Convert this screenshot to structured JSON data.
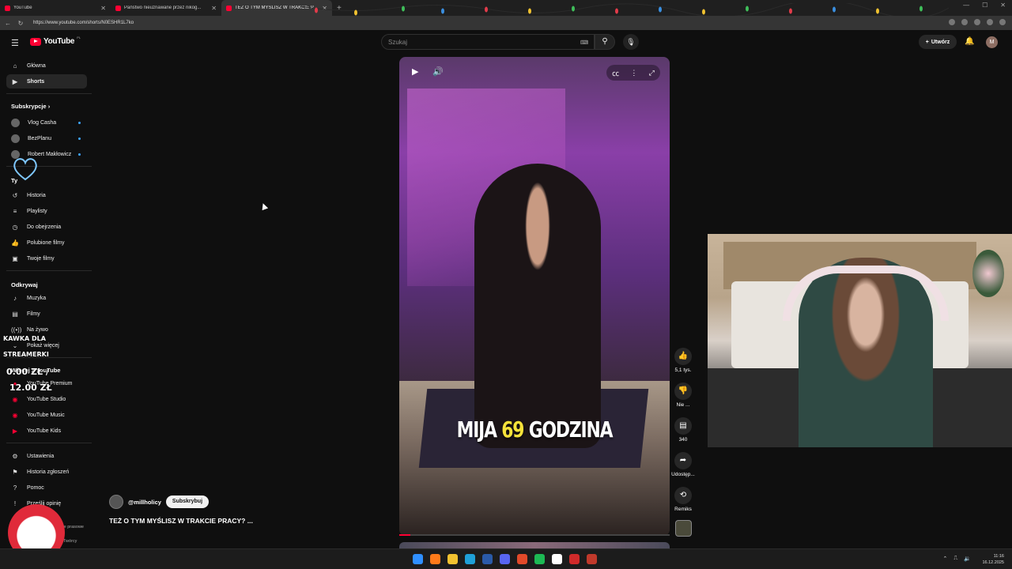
{
  "browser": {
    "tabs": [
      {
        "title": "YouTube"
      },
      {
        "title": "Państwo nieuznawane przez nikog..."
      },
      {
        "title": "TEŻ O TYM MYŚLISZ W TRAKCIE P..."
      }
    ],
    "url": "https://www.youtube.com/shorts/N0ESHR1L7ko"
  },
  "topbar": {
    "logo_text": "YouTube",
    "logo_country": "PL",
    "search_placeholder": "Szukaj",
    "create_label": "Utwórz",
    "avatar_letter": "M"
  },
  "sidebar": {
    "main": [
      {
        "label": "Główna",
        "icon": "home-icon"
      },
      {
        "label": "Shorts",
        "icon": "shorts-icon"
      }
    ],
    "subs_heading": "Subskrypcje",
    "subscriptions": [
      {
        "label": "Vlog Casha"
      },
      {
        "label": "BezPlanu"
      },
      {
        "label": "Robert Makłowicz"
      }
    ],
    "you_heading": "Ty",
    "you": [
      {
        "label": "Historia",
        "icon": "history-icon"
      },
      {
        "label": "Playlisty",
        "icon": "playlist-icon"
      },
      {
        "label": "Do obejrzenia",
        "icon": "watch-later-icon"
      },
      {
        "label": "Polubione filmy",
        "icon": "like-icon"
      },
      {
        "label": "Twoje filmy",
        "icon": "video-icon"
      }
    ],
    "explore_heading": "Odkrywaj",
    "explore": [
      {
        "label": "Muzyka",
        "icon": "music-icon"
      },
      {
        "label": "Filmy",
        "icon": "film-icon"
      },
      {
        "label": "Na żywo",
        "icon": "live-icon"
      },
      {
        "label": "Pokaż więcej",
        "icon": "chevron-down-icon"
      }
    ],
    "more_heading": "Więcej z YouTube",
    "more": [
      {
        "label": "YouTube Premium"
      },
      {
        "label": "YouTube Studio"
      },
      {
        "label": "YouTube Music"
      },
      {
        "label": "YouTube Kids"
      }
    ],
    "settings": [
      {
        "label": "Ustawienia",
        "icon": "gear-icon"
      },
      {
        "label": "Historia zgłoszeń",
        "icon": "flag-icon"
      },
      {
        "label": "Pomoc",
        "icon": "help-icon"
      },
      {
        "label": "Prześlij opinię",
        "icon": "feedback-icon"
      }
    ],
    "footer_partial": [
      "Informacje prasowe",
      "Twórcy"
    ]
  },
  "short": {
    "caption_pre": "MIJA",
    "caption_num": "69",
    "caption_post": "GODZINA",
    "channel": "@millholicy",
    "subscribe_label": "Subskrybuj",
    "title": "TEŻ O TYM MYŚLISZ W TRAKCIE PRACY? ...",
    "progress": 0.04,
    "actions": {
      "likes": "5,1 tys.",
      "dislike": "Nie ...",
      "comments": "340",
      "share": "Udostęp...",
      "remix": "Remiks"
    }
  },
  "overlay": {
    "donation_line1": "KAWKA DLA",
    "donation_line2": "STREAMERKI",
    "amount1": "0.00 ZŁ /",
    "amount2": "12.00 ZŁ"
  },
  "taskbar": {
    "time": "11:16",
    "date": "16.12.2025"
  }
}
